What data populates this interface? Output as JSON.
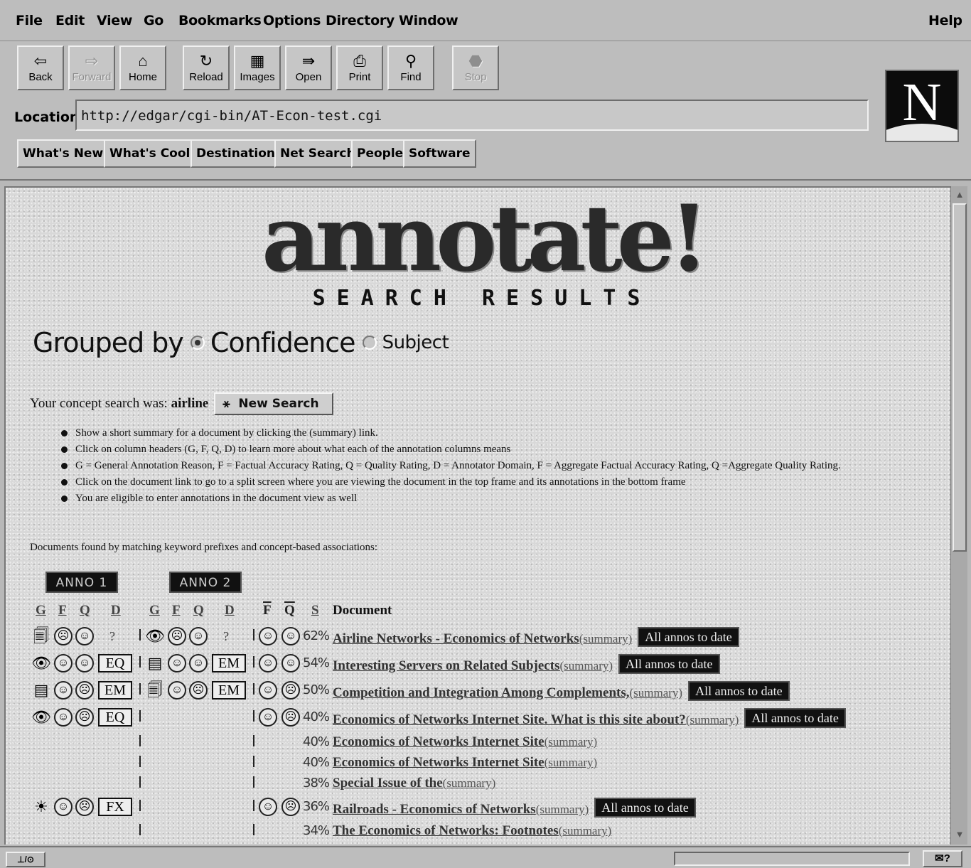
{
  "menubar": {
    "items": [
      "File",
      "Edit",
      "View",
      "Go",
      "Bookmarks",
      "Options",
      "Directory",
      "Window"
    ],
    "help": "Help"
  },
  "toolbar": {
    "buttons": [
      {
        "label": "Back",
        "icon": "back-arrow-icon",
        "enabled": true
      },
      {
        "label": "Forward",
        "icon": "forward-arrow-icon",
        "enabled": false
      },
      {
        "label": "Home",
        "icon": "home-icon",
        "enabled": true
      },
      {
        "label": "Reload",
        "icon": "reload-icon",
        "enabled": true
      },
      {
        "label": "Images",
        "icon": "images-icon",
        "enabled": true
      },
      {
        "label": "Open",
        "icon": "open-icon",
        "enabled": true
      },
      {
        "label": "Print",
        "icon": "print-icon",
        "enabled": true
      },
      {
        "label": "Find",
        "icon": "find-icon",
        "enabled": true
      },
      {
        "label": "Stop",
        "icon": "stop-icon",
        "enabled": false
      }
    ]
  },
  "location": {
    "label": "Location:",
    "url": "http://edgar/cgi-bin/AT-Econ-test.cgi"
  },
  "directory_buttons": [
    "What's New?",
    "What's Cool?",
    "Destinations",
    "Net Search",
    "People",
    "Software"
  ],
  "logo": {
    "letter": "N"
  },
  "banner": {
    "title": "annotate!",
    "subtitle": "SEARCH RESULTS"
  },
  "grouping": {
    "label": "Grouped by",
    "option_confidence": "Confidence",
    "option_subject": "Subject",
    "selected": "Confidence"
  },
  "search": {
    "prefix": "Your concept search was:",
    "term": "airline",
    "new_search_label": "New Search"
  },
  "instructions": [
    "Show a short summary for a document by clicking the (summary) link.",
    "Click on column headers (G, F, Q, D) to learn more about what each of the annotation columns means",
    "G = General Annotation Reason, F = Factual Accuracy Rating, Q = Quality Rating, D = Annotator Domain, F = Aggregate Factual Accuracy Rating, Q =Aggregate Quality Rating.",
    "Click on the document link to go to a split screen where you are viewing the document in the top frame and its annotations in the bottom frame",
    "You are eligible to enter annotations in the document view as well"
  ],
  "docs_found": "Documents found by matching keyword prefixes and concept-based associations:",
  "anno_headers": [
    "ANNO 1",
    "ANNO 2"
  ],
  "column_headers": {
    "anno": [
      "G",
      "F",
      "Q",
      "D"
    ],
    "aggregate": [
      "F",
      "Q"
    ],
    "score": "S",
    "document": "Document"
  },
  "summary_label": "(summary)",
  "all_annos_label": "All annos to date",
  "results": [
    {
      "anno1": {
        "g": "doc-icon",
        "f": "frown-icon",
        "q": "smile-icon",
        "d": "?"
      },
      "anno2": {
        "g": "eye-icon",
        "f": "frown-icon",
        "q": "smile-icon",
        "d": "?"
      },
      "agg": {
        "f": "smile-icon",
        "q": "smile-icon"
      },
      "score": "62%",
      "title": "Airline Networks - Economics of Networks",
      "all_annos": true
    },
    {
      "anno1": {
        "g": "eye-icon",
        "f": "smile-icon",
        "q": "smile-icon",
        "d": "EQ"
      },
      "anno2": {
        "g": "note-icon",
        "f": "smile-icon",
        "q": "smile-icon",
        "d": "EM"
      },
      "agg": {
        "f": "smile-icon",
        "q": "smile-icon"
      },
      "score": "54%",
      "title": "Interesting Servers on Related Subjects",
      "all_annos": true
    },
    {
      "anno1": {
        "g": "note-icon",
        "f": "smile-icon",
        "q": "frown-icon",
        "d": "EM"
      },
      "anno2": {
        "g": "doc-icon",
        "f": "smile-icon",
        "q": "frown-icon",
        "d": "EM"
      },
      "agg": {
        "f": "smile-icon",
        "q": "frown-icon"
      },
      "score": "50%",
      "title": "Competition and Integration Among Complements,",
      "all_annos": true
    },
    {
      "anno1": {
        "g": "eye-icon",
        "f": "smile-icon",
        "q": "frown-icon",
        "d": "EQ"
      },
      "anno2": null,
      "agg": {
        "f": "smile-icon",
        "q": "frown-icon"
      },
      "score": "40%",
      "title": "Economics of Networks Internet Site. What is this site about?",
      "all_annos": true
    },
    {
      "anno1": null,
      "anno2": null,
      "agg": null,
      "score": "40%",
      "title": "Economics of Networks Internet Site",
      "all_annos": false
    },
    {
      "anno1": null,
      "anno2": null,
      "agg": null,
      "score": "40%",
      "title": "Economics of Networks Internet Site",
      "all_annos": false
    },
    {
      "anno1": null,
      "anno2": null,
      "agg": null,
      "score": "38%",
      "title": "Special Issue of the",
      "all_annos": false
    },
    {
      "anno1": {
        "g": "lightbulb-icon",
        "f": "smile-icon",
        "q": "frown-icon",
        "d": "FX"
      },
      "anno2": null,
      "agg": {
        "f": "smile-icon",
        "q": "frown-icon"
      },
      "score": "36%",
      "title": "Railroads - Economics of Networks",
      "all_annos": true
    },
    {
      "anno1": null,
      "anno2": null,
      "agg": null,
      "score": "34%",
      "title": "The Economics of Networks: Footnotes",
      "all_annos": false
    }
  ],
  "status": {
    "left": "⊥/⊙",
    "right": "✉?"
  }
}
